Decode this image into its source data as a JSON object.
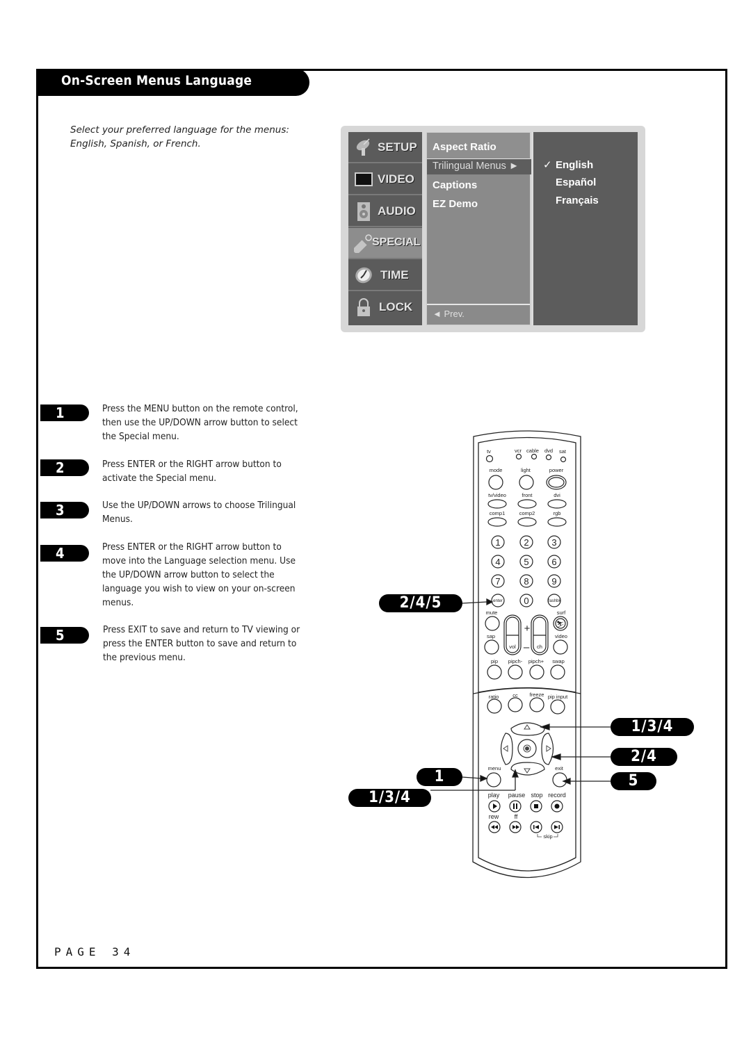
{
  "header": {
    "title": "On-Screen Menus Language"
  },
  "intro": "Select your preferred language for the menus: English, Spanish, or French.",
  "osd_menu": {
    "categories": [
      {
        "label": "SETUP",
        "icon": "satellite-dish-icon",
        "active": false
      },
      {
        "label": "VIDEO",
        "icon": "tv-screen-icon",
        "active": false
      },
      {
        "label": "AUDIO",
        "icon": "speaker-icon",
        "active": false
      },
      {
        "label": "SPECIAL",
        "icon": "key-tag-icon",
        "active": true
      },
      {
        "label": "TIME",
        "icon": "clock-icon",
        "active": false
      },
      {
        "label": "LOCK",
        "icon": "padlock-icon",
        "active": false
      }
    ],
    "items": [
      "Aspect Ratio",
      "Trilingual Menus ►",
      "Captions",
      "EZ Demo"
    ],
    "selected_item": "Trilingual Menus",
    "prev_label": "◄ Prev.",
    "languages": [
      "English",
      "Español",
      "Français"
    ],
    "checked_language": "English",
    "check_mark": "✓"
  },
  "steps": [
    {
      "number": "1",
      "text": "Press the MENU button on the remote control, then use the UP/DOWN arrow button to select the Special menu."
    },
    {
      "number": "2",
      "text": "Press ENTER or the RIGHT arrow button to activate the Special menu."
    },
    {
      "number": "3",
      "text": "Use the UP/DOWN arrows to choose Trilingual Menus."
    },
    {
      "number": "4",
      "text": "Press ENTER or the RIGHT arrow button to move into the Language selection menu. Use the UP/DOWN arrow button to select the language you wish to view on your on-screen menus."
    },
    {
      "number": "5",
      "text": "Press EXIT to save and return to TV viewing or press the ENTER button to save and return to the previous menu."
    }
  ],
  "callouts": {
    "enter": "2/4/5",
    "menu": "1",
    "down": "1/3/4",
    "up": "1/3/4",
    "right": "2/4",
    "exit": "5"
  },
  "remote": {
    "modes": [
      "tv",
      "vcr",
      "cable",
      "dvd",
      "sat"
    ],
    "row1": [
      "mode",
      "light",
      "power"
    ],
    "row2": [
      "tv/video",
      "front",
      "dvi"
    ],
    "row3": [
      "comp1",
      "comp2",
      "rgb"
    ],
    "digits": [
      "1",
      "2",
      "3",
      "4",
      "5",
      "6",
      "7",
      "8",
      "9"
    ],
    "enter": "enter",
    "zero": "0",
    "flashbk": "flashbk",
    "mute": "mute",
    "surf": "surf",
    "sap": "sap",
    "video": "video",
    "vol": "vol",
    "ch": "ch",
    "plus": "+",
    "minus": "–",
    "pip_row": [
      "pip",
      "pipch-",
      "pipch+",
      "swap"
    ],
    "func_row": [
      "ratio",
      "cc",
      "freeze",
      "pip input"
    ],
    "menu": "menu",
    "exit": "exit",
    "transport1": [
      "play",
      "pause",
      "stop",
      "record"
    ],
    "transport2": [
      "rew",
      "ff"
    ],
    "skip": "skip"
  },
  "footer": {
    "page_label": "PAGE 34"
  }
}
